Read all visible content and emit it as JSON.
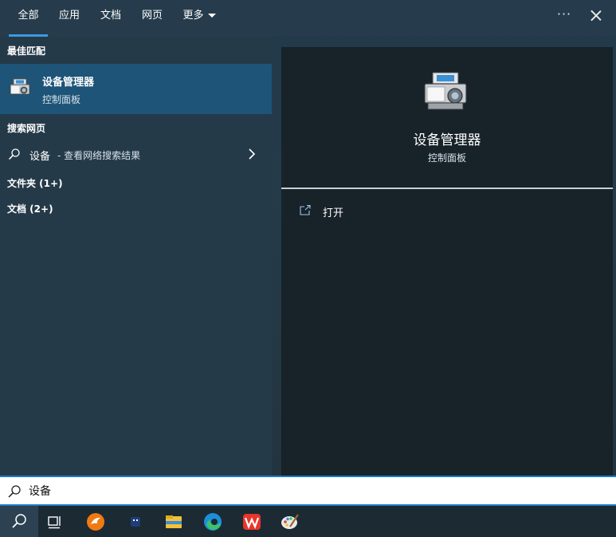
{
  "tabs": [
    {
      "label": "全部",
      "active": true
    },
    {
      "label": "应用",
      "active": false
    },
    {
      "label": "文档",
      "active": false
    },
    {
      "label": "网页",
      "active": false
    },
    {
      "label": "更多",
      "active": false
    }
  ],
  "window_controls": {
    "more": "···"
  },
  "left": {
    "best_match_label": "最佳匹配",
    "best_match": {
      "title": "设备管理器",
      "subtitle": "控制面板",
      "icon": "device-manager-icon"
    },
    "web_label": "搜索网页",
    "web_result": {
      "term": "设备",
      "rest": "- 查看网络搜索结果"
    },
    "folders_label": "文件夹 (1+)",
    "documents_label": "文档 (2+)"
  },
  "detail": {
    "title": "设备管理器",
    "subtitle": "控制面板",
    "actions": [
      {
        "label": "打开",
        "icon": "open-icon"
      }
    ]
  },
  "search": {
    "value": "设备"
  },
  "taskbar": [
    "search-icon",
    "task-view-icon",
    "fox-app-icon",
    "blue-app-icon",
    "file-explorer-icon",
    "edge-icon",
    "wps-icon",
    "paint-icon"
  ],
  "colors": {
    "accent": "#3b9ae1",
    "selected": "#1d5478",
    "searchbar_border": "#1a7bc9"
  }
}
